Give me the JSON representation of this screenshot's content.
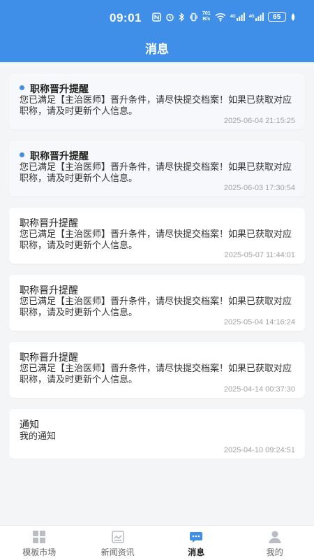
{
  "status_bar": {
    "time": "09:01",
    "net_speed_top": "701",
    "net_speed_bottom": "B/s",
    "signal_1": "4G",
    "signal_2": "4G",
    "battery": "65"
  },
  "header": {
    "title": "消息"
  },
  "messages": [
    {
      "title": "职称晋升提醒",
      "unread": true,
      "body": "您已满足【主治医师】晋升条件，请尽快提交档案！如果已获取对应职称，请及时更新个人信息。",
      "time": "2025-06-04 21:15:25"
    },
    {
      "title": "职称晋升提醒",
      "unread": true,
      "body": "您已满足【主治医师】晋升条件，请尽快提交档案！如果已获取对应职称，请及时更新个人信息。",
      "time": "2025-06-03 17:30:54"
    },
    {
      "title": "职称晋升提醒",
      "unread": false,
      "body": "您已满足【主治医师】晋升条件，请尽快提交档案！如果已获取对应职称，请及时更新个人信息。",
      "time": "2025-05-07 11:44:01"
    },
    {
      "title": "职称晋升提醒",
      "unread": false,
      "body": "您已满足【主治医师】晋升条件，请尽快提交档案！如果已获取对应职称，请及时更新个人信息。",
      "time": "2025-05-04 14:16:24"
    },
    {
      "title": "职称晋升提醒",
      "unread": false,
      "body": "您已满足【主治医师】晋升条件，请尽快提交档案！如果已获取对应职称，请及时更新个人信息。",
      "time": "2025-04-14 00:37:30"
    },
    {
      "title": "通知",
      "unread": false,
      "body": "我的通知",
      "time": "2025-04-10 09:24:51"
    }
  ],
  "tabbar": {
    "items": [
      {
        "label": "模板市场",
        "icon": "grid-icon",
        "active": false
      },
      {
        "label": "新闻资讯",
        "icon": "news-icon",
        "active": false
      },
      {
        "label": "消息",
        "icon": "chat-icon",
        "active": true
      },
      {
        "label": "我的",
        "icon": "person-icon",
        "active": false
      }
    ]
  },
  "colors": {
    "accent": "#3f8ee8",
    "background": "#f4f5f7",
    "muted": "#a3a3a3"
  }
}
